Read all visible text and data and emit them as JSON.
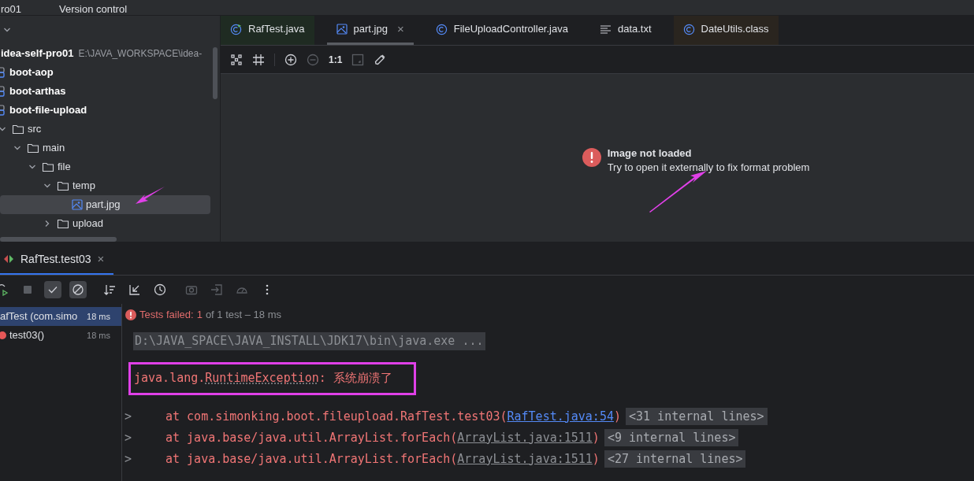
{
  "top_bar": {
    "project": "ro01",
    "menu": "Version control"
  },
  "project_panel": {
    "root": {
      "name": "idea-self-pro01",
      "path": "E:\\JAVA_WORKSPACE\\idea-"
    },
    "tree": [
      {
        "kind": "module",
        "name": "boot-aop",
        "selected": false
      },
      {
        "kind": "module",
        "name": "boot-arthas",
        "selected": false
      },
      {
        "kind": "module",
        "name": "boot-file-upload",
        "selected": false,
        "children": [
          {
            "kind": "folder",
            "name": "src",
            "expanded": true,
            "selected": false,
            "children": [
              {
                "kind": "folder",
                "name": "main",
                "expanded": true,
                "selected": false,
                "children": [
                  {
                    "kind": "folder",
                    "name": "file",
                    "expanded": true,
                    "selected": false,
                    "children": [
                      {
                        "kind": "folder",
                        "name": "temp",
                        "expanded": true,
                        "selected": false,
                        "children": [
                          {
                            "kind": "image",
                            "name": "part.jpg",
                            "selected": true
                          }
                        ]
                      },
                      {
                        "kind": "folder",
                        "name": "upload",
                        "expanded": false,
                        "selected": false
                      }
                    ]
                  }
                ]
              }
            ]
          }
        ]
      }
    ]
  },
  "editor_tabs": [
    {
      "label": "RafTest.java",
      "kind": "run-class",
      "selected": false,
      "closable": false,
      "color": "#1f2b22"
    },
    {
      "label": "part.jpg",
      "kind": "image",
      "selected": true,
      "closable": true,
      "close": "×"
    },
    {
      "label": "FileUploadController.java",
      "kind": "class",
      "selected": false,
      "closable": false
    },
    {
      "label": "data.txt",
      "kind": "text",
      "selected": false,
      "closable": false
    },
    {
      "label": "DateUtils.class",
      "kind": "class",
      "selected": false,
      "closable": false,
      "color": "#2a251f"
    }
  ],
  "image_toolbar": [
    {
      "kind": "grid",
      "disabled": false
    },
    {
      "kind": "crop",
      "disabled": false
    },
    {
      "kind": "zoom-in",
      "disabled": false
    },
    {
      "kind": "zoom-out",
      "disabled": true
    },
    {
      "kind": "actual-size",
      "label": "1:1",
      "disabled": false
    },
    {
      "kind": "fit",
      "disabled": true
    },
    {
      "kind": "picker",
      "disabled": false
    }
  ],
  "image_message": {
    "title": "Image not loaded",
    "detail": "Try to open it externally to fix format problem"
  },
  "run_tab": {
    "label": "RafTest.test03",
    "close": "×",
    "selected": true
  },
  "run_toolbar": [
    {
      "kind": "rerun",
      "on": false,
      "disabled": false
    },
    {
      "kind": "stop",
      "on": false,
      "disabled": true
    },
    {
      "kind": "show-passed",
      "on": true,
      "disabled": false
    },
    {
      "kind": "show-ignored",
      "on": true,
      "disabled": false
    },
    {
      "kind": "sort",
      "on": false,
      "disabled": false
    },
    {
      "kind": "collapse",
      "on": false,
      "disabled": false
    },
    {
      "kind": "history",
      "on": false,
      "disabled": false
    },
    {
      "kind": "camera",
      "on": false,
      "disabled": true
    },
    {
      "kind": "export",
      "on": false,
      "disabled": true
    },
    {
      "kind": "gauge",
      "on": false,
      "disabled": true
    },
    {
      "kind": "more",
      "on": false,
      "disabled": false
    }
  ],
  "test_tree": [
    {
      "name": "afTest (com.simo",
      "time": "18 ms",
      "failed": false,
      "selected": true
    },
    {
      "name": "test03()",
      "time": "18 ms",
      "failed": true,
      "selected": false
    }
  ],
  "test_status": {
    "label": "Tests failed:",
    "count": "1",
    "detail": "of 1 test – 18 ms"
  },
  "console": {
    "command": "D:\\JAVA_SPACE\\JAVA_INSTALL\\JDK17\\bin\\java.exe ...",
    "exception": {
      "package": "java.lang.",
      "class": "RuntimeException",
      "message": ": 系统崩溃了"
    },
    "frames": [
      {
        "expander": ">",
        "text": "at com.simonking.boot.fileupload.RafTest.test03(",
        "link": "RafTest.java:54",
        "end": ")",
        "folded": "<31 internal lines>",
        "highlight_link": true
      },
      {
        "expander": ">",
        "text": "at java.base/java.util.ArrayList.forEach(",
        "link": "ArrayList.java:1511",
        "end": ")",
        "folded": "<9 internal lines>",
        "highlight_link": false
      },
      {
        "expander": ">",
        "text": "at java.base/java.util.ArrayList.forEach(",
        "link": "ArrayList.java:1511",
        "end": ")",
        "folded": "<27 internal lines>",
        "highlight_link": false
      }
    ]
  }
}
